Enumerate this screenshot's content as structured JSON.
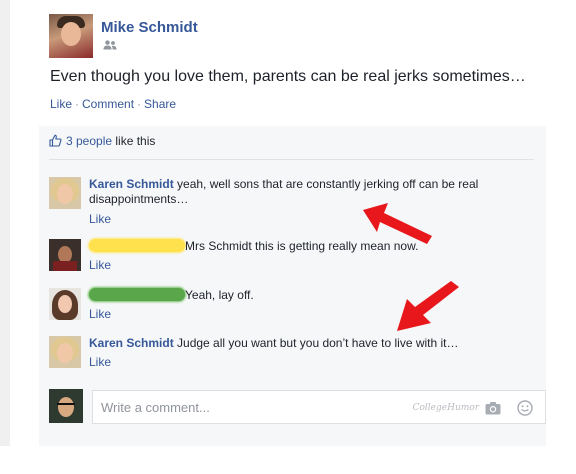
{
  "post": {
    "author": "Mike Schmidt",
    "text": "Even though you love them, parents can be real jerks sometimes…",
    "actions": {
      "like": "Like",
      "comment": "Comment",
      "share": "Share",
      "separator": "·"
    },
    "audience_icon": "friends-icon"
  },
  "likes": {
    "count_text": "3 people",
    "suffix": " like this",
    "icon": "thumbs-up-icon"
  },
  "comments": [
    {
      "author": "Karen Schmidt",
      "text": " yeah, well sons that are constantly jerking off can be real disappointments…",
      "like": "Like"
    },
    {
      "author": "",
      "text": "Mrs Schmidt this is getting really mean now.",
      "like": "Like",
      "name_redacted": "yellow"
    },
    {
      "author": "",
      "text": "Yeah, lay off.",
      "like": "Like",
      "name_redacted": "green"
    },
    {
      "author": "Karen Schmidt",
      "text": " Judge all you want but you don’t have to live with it…",
      "like": "Like"
    }
  ],
  "composer": {
    "placeholder": "Write a comment...",
    "watermark": "CollegeHumor",
    "icons": [
      "camera-icon",
      "smiley-icon"
    ]
  },
  "colors": {
    "link": "#365899",
    "text": "#1d2129",
    "ufi_bg": "#f6f7f9",
    "arrow": "#e8171b"
  }
}
